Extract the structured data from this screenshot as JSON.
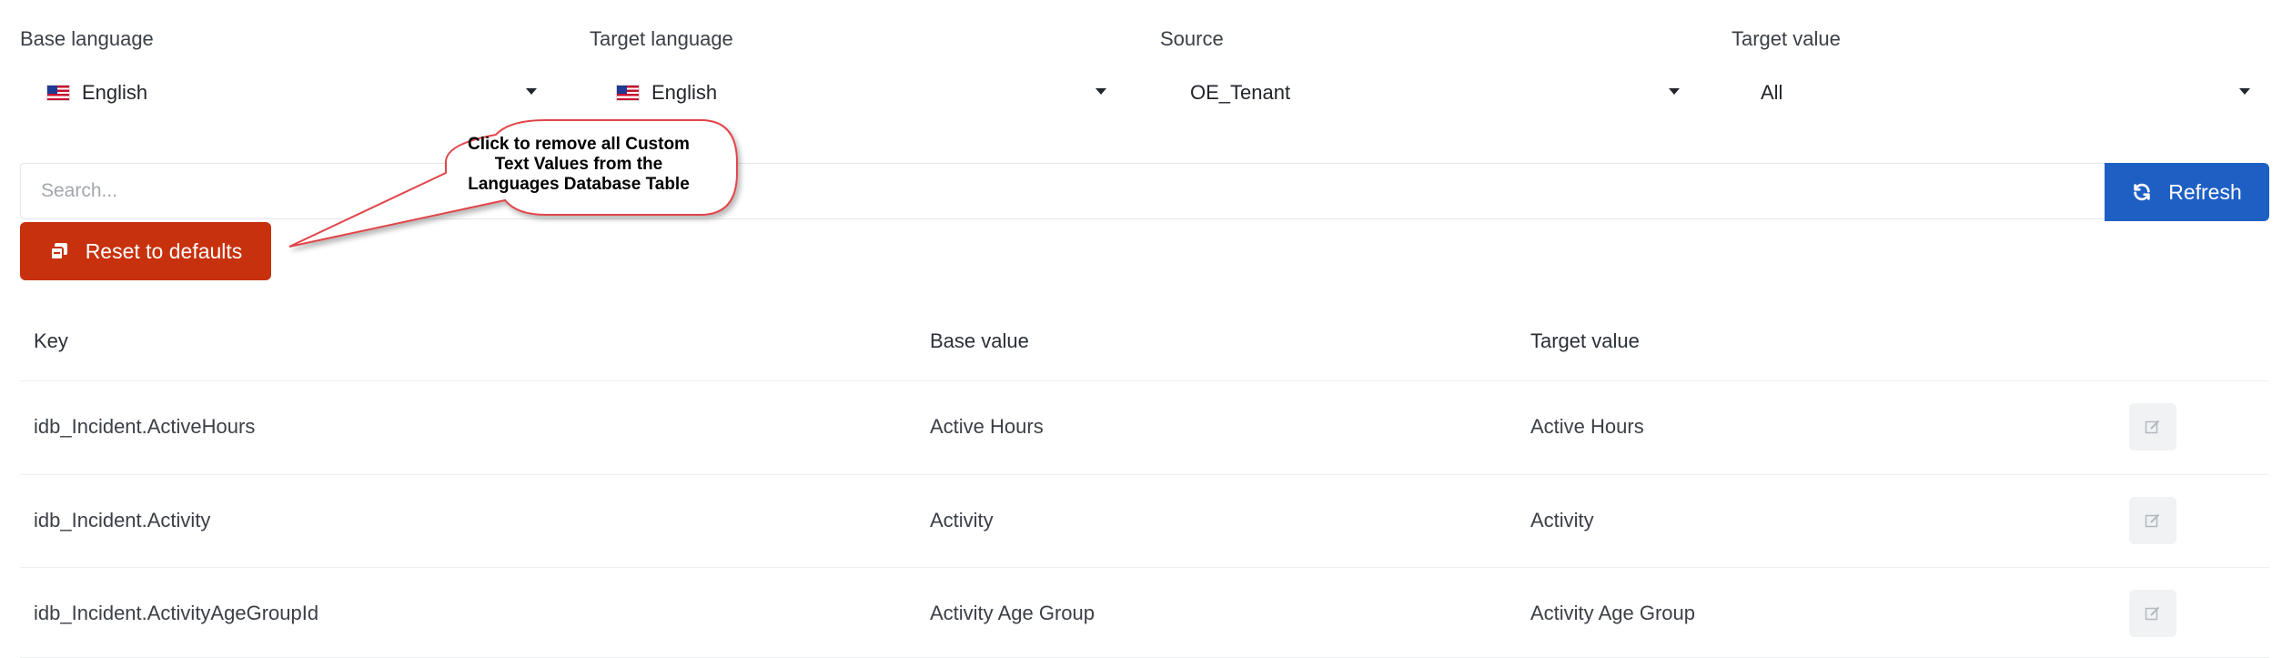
{
  "filters": {
    "base_language": {
      "label": "Base language",
      "value": "English",
      "flag_icon": "us-flag-icon"
    },
    "target_language": {
      "label": "Target language",
      "value": "English",
      "flag_icon": "us-flag-icon"
    },
    "source": {
      "label": "Source",
      "value": "OE_Tenant"
    },
    "target_value": {
      "label": "Target value",
      "value": "All"
    }
  },
  "search": {
    "placeholder": "Search..."
  },
  "buttons": {
    "refresh_label": "Refresh",
    "refresh_icon": "refresh-icon",
    "reset_label": "Reset to defaults",
    "reset_icon": "copy-icon"
  },
  "callout": {
    "lines": [
      "Click to remove all Custom",
      "Text Values from the",
      "Languages Database Table"
    ],
    "border_color": "#e0454a"
  },
  "table": {
    "headers": {
      "key": "Key",
      "base": "Base value",
      "target": "Target value"
    },
    "rows": [
      {
        "key": "idb_Incident.ActiveHours",
        "base": "Active Hours",
        "target": "Active Hours"
      },
      {
        "key": "idb_Incident.Activity",
        "base": "Activity",
        "target": "Activity"
      },
      {
        "key": "idb_Incident.ActivityAgeGroupId",
        "base": "Activity Age Group",
        "target": "Activity Age Group"
      }
    ]
  },
  "colors": {
    "primary": "#1e5fc4",
    "danger": "#c7310d"
  }
}
